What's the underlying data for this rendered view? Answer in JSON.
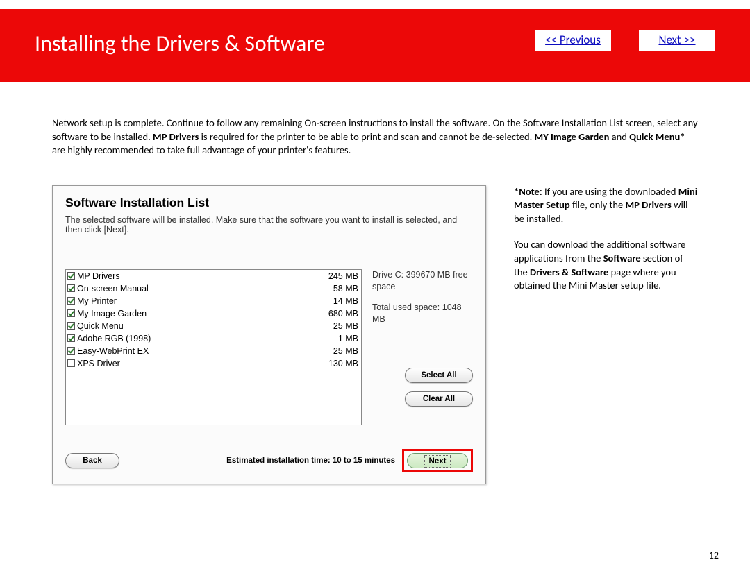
{
  "banner": {
    "title": "Installing the Drivers & Software",
    "prev": "<< Previous",
    "next": "Next >>"
  },
  "intro": {
    "part1": "Network setup is complete.  Continue to follow any remaining On-screen instructions to install the software. On the Software Installation List screen, select any software to be installed.  ",
    "bold1": "MP Drivers",
    "part2": "  is required for the printer to be able to print and scan and cannot be de-selected.  ",
    "bold2": "MY Image Garden",
    "part3": " and ",
    "bold3": "Quick Menu*",
    "part4": " are highly recommended to take full advantage of your printer's features."
  },
  "dialog": {
    "title": "Software Installation List",
    "subtitle": "The selected software will be installed. Make sure that the software you want to install is selected, and then click [Next].",
    "items": [
      {
        "name": "MP Drivers",
        "size": "245 MB",
        "checked": true
      },
      {
        "name": "On-screen Manual",
        "size": "58 MB",
        "checked": true
      },
      {
        "name": "My Printer",
        "size": "14 MB",
        "checked": true
      },
      {
        "name": "My Image Garden",
        "size": "680 MB",
        "checked": true
      },
      {
        "name": "Quick Menu",
        "size": "25 MB",
        "checked": true
      },
      {
        "name": "Adobe RGB (1998)",
        "size": "1 MB",
        "checked": true
      },
      {
        "name": "Easy-WebPrint EX",
        "size": "25 MB",
        "checked": true
      },
      {
        "name": "XPS Driver",
        "size": "130 MB",
        "checked": false
      }
    ],
    "disk_free": "Drive C: 399670 MB free space",
    "disk_used": "Total used space: 1048 MB",
    "select_all": "Select All",
    "clear_all": "Clear All",
    "back": "Back",
    "est_time": "Estimated installation time: 10 to 15 minutes",
    "next": "Next"
  },
  "notes": {
    "note_prefix": "*Note:",
    "note_1a": " If you are using the downloaded  ",
    "note_1b": "Mini Master Setup",
    "note_1c": " file, only the ",
    "note_1d": "MP Drivers",
    "note_1e": "  will be installed.",
    "note_2a": "You can download the additional software applications from the ",
    "note_2b": "Software",
    "note_2c": " section of the ",
    "note_2d": "Drivers & Software",
    "note_2e": " page where you obtained the Mini Master setup file."
  },
  "page_number": "12"
}
